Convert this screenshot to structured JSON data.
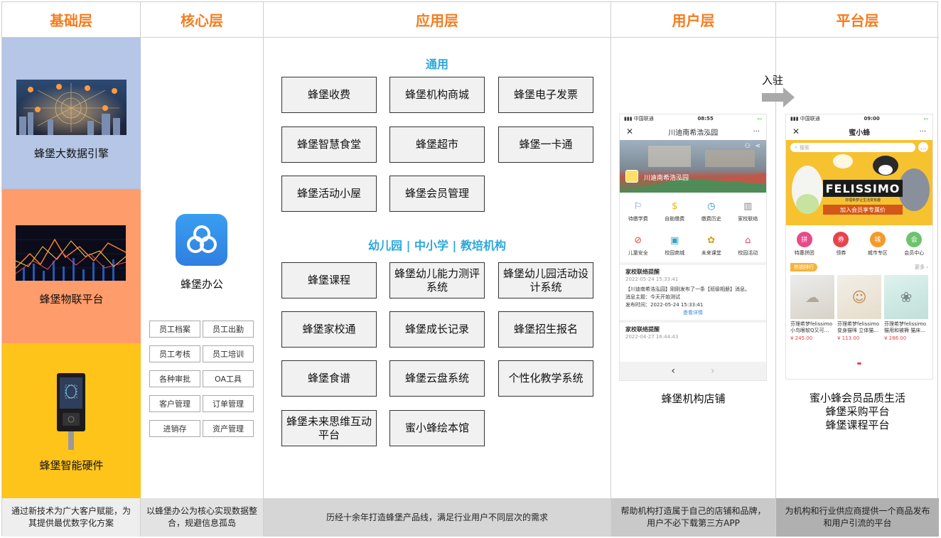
{
  "headers": {
    "base": "基础层",
    "core": "核心层",
    "app": "应用层",
    "user": "用户层",
    "platform": "平台层"
  },
  "base": {
    "layer1": "蜂堡大数据引擎",
    "layer2": "蜂堡物联平台",
    "layer3": "蜂堡智能硬件",
    "footer": "通过新技术为广大客户赋能，为其提供最优数字化方案"
  },
  "core": {
    "name": "蜂堡办公",
    "items": [
      "员工档案",
      "员工出勤",
      "员工考核",
      "员工培训",
      "各种审批",
      "OA工具",
      "客户管理",
      "订单管理",
      "进销存",
      "资产管理"
    ],
    "footer": "以蜂堡办公为核心实现数据整合，规避信息孤岛"
  },
  "app": {
    "section_general": "通用",
    "general": [
      "蜂堡收费",
      "蜂堡机构商城",
      "蜂堡电子发票",
      "蜂堡智慧食堂",
      "蜂堡超市",
      "蜂堡一卡通",
      "蜂堡活动小屋",
      "蜂堡会员管理"
    ],
    "section_edu": "幼儿园 | 中小学 | 教培机构",
    "edu": [
      "蜂堡课程",
      "蜂堡幼儿能力测评系统",
      "蜂堡幼儿园活动设计系统",
      "蜂堡家校通",
      "蜂堡成长记录",
      "蜂堡招生报名",
      "蜂堡食谱",
      "蜂堡云盘系统",
      "个性化教学系统",
      "蜂堡未来思维互动平台",
      "蜜小蜂绘本馆"
    ],
    "footer": "历经十余年打造蜂堡产品线，满足行业用户不同层次的需求"
  },
  "user": {
    "phone": {
      "carrier": "中国联通",
      "time": "08:55",
      "title": "川迪南希浩泓园",
      "more": "···",
      "banner_label": "川迪南希浩泓园",
      "icons": [
        {
          "label": "待缴学费",
          "icon": "flag-icon"
        },
        {
          "label": "自助缴费",
          "icon": "dollar-icon"
        },
        {
          "label": "缴费历史",
          "icon": "history-icon"
        },
        {
          "label": "家校联络",
          "icon": "building-icon"
        },
        {
          "label": "儿童安全",
          "icon": "alert-icon"
        },
        {
          "label": "校园商城",
          "icon": "bag-icon"
        },
        {
          "label": "未来课堂",
          "icon": "bee-icon"
        },
        {
          "label": "校园活动",
          "icon": "house-icon"
        }
      ],
      "notice_title": "家校联络提醒",
      "notice_time": "2022-05-24 15:33:41",
      "notice_body": "【川迪南希浩泓园】刚刚发布了一条【班级相册】消息。",
      "notice_subject": "消息主题：今天开始测试",
      "notice_pubtime": "发布时间：2022-05-24 15:33:41",
      "notice_link": "查看详情",
      "notice2_title": "家校联络提醒",
      "notice2_time": "2022-04-27 16:44:43"
    },
    "caption": "蜂堡机构店铺",
    "footer": "帮助机构打造属于自己的店铺和品牌，用户不必下载第三方APP"
  },
  "platform": {
    "arrow_label": "入驻",
    "phone": {
      "carrier": "中国联通",
      "time": "09:00",
      "title": "蜜小蜂",
      "more": "···",
      "search_placeholder": "搜索",
      "brand": "FELISSIMO",
      "brand_sub": "芬理希梦让生活变有趣",
      "banner_cta": "加入会员享专属价",
      "cats": [
        {
          "label": "特惠拼团",
          "glyph": "拼",
          "color": "#e84a8a"
        },
        {
          "label": "领券",
          "glyph": "券",
          "color": "#e8434b"
        },
        {
          "label": "城市专区",
          "glyph": "城",
          "color": "#f39a2b"
        },
        {
          "label": "会员中心",
          "glyph": "会",
          "color": "#6cc36c"
        }
      ],
      "hot_tag": "热销排行",
      "more_link": "更多 ›",
      "products": [
        {
          "name": "芬理希梦felissimo小鸟眼软Q又可…",
          "price": "¥ 245.00"
        },
        {
          "name": "芬理希梦felissimo变身猫咪 立体猫…",
          "price": "¥ 113.00"
        },
        {
          "name": "芬理希梦felissimo猫用和被褥 猫床…",
          "price": "¥ 286.00"
        }
      ]
    },
    "captions": [
      "蜜小蜂会员品质生活",
      "蜂堡采购平台",
      "蜂堡课程平台"
    ],
    "footer": "为机构和行业供应商提供一个商品发布和用户引流的平台"
  },
  "colors": {
    "header": "#f47c1f",
    "section": "#2aa8dc",
    "band1": "#b5c6e6",
    "band2": "#ff9c6b",
    "band3": "#ffc419",
    "foot_light": "#eeeeee",
    "foot_mid": "#c9c9c9",
    "foot_dark": "#b0b0b0"
  }
}
